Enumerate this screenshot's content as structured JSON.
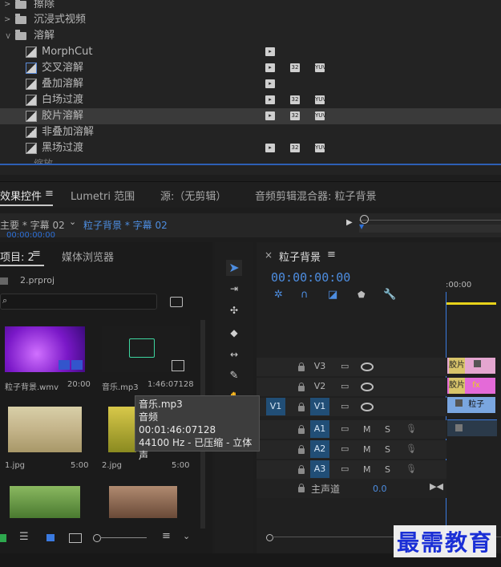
{
  "effects_tree": {
    "folders": [
      {
        "label": "擦除",
        "expanded": false
      },
      {
        "label": "沉浸式视频",
        "expanded": false
      },
      {
        "label": "溶解",
        "expanded": true
      }
    ],
    "items": [
      {
        "label": "MorphCut",
        "badges": [
          "accel"
        ]
      },
      {
        "label": "交叉溶解",
        "badges": [
          "accel",
          "32",
          "yuv"
        ],
        "highlight": true
      },
      {
        "label": "叠加溶解",
        "badges": [
          "accel"
        ]
      },
      {
        "label": "白场过渡",
        "badges": [
          "accel",
          "32",
          "yuv"
        ]
      },
      {
        "label": "胶片溶解",
        "badges": [
          "accel",
          "32",
          "yuv"
        ],
        "selected": true
      },
      {
        "label": "非叠加溶解",
        "badges": []
      },
      {
        "label": "黑场过渡",
        "badges": [
          "accel",
          "32",
          "yuv"
        ]
      }
    ],
    "partial_next": "缩放"
  },
  "panel_tabs": {
    "effect_controls": "效果控件",
    "lumetri": "Lumetri 范围",
    "source": "源:（无剪辑）",
    "audio_mixer": "音频剪辑混合器: 粒子背景",
    "menu_glyph": "≡"
  },
  "effect_controls_row": {
    "master": "主要 * 字幕 02",
    "clip": "粒子背景 * 字幕 02",
    "timecode": "00:00:00:00"
  },
  "project": {
    "tab": "项目: 2",
    "media_browser": "媒体浏览器",
    "file": "2.prproj",
    "items": [
      {
        "name": "粒子背景.wmv",
        "dur": "20:00"
      },
      {
        "name": "音乐.mp3",
        "dur": "1:46:07128"
      },
      {
        "name": "1.jpg",
        "dur": "5:00"
      },
      {
        "name": "2.jpg",
        "dur": "5:00"
      }
    ]
  },
  "tooltip": {
    "line1": "音乐.mp3",
    "line2": "音频",
    "line3": "00:01:46:07128",
    "line4": "44100 Hz - 已压缩 - 立体声"
  },
  "timeline": {
    "tab": "粒子背景",
    "timecode": "00:00:00:00",
    "ruler": ":00:00",
    "tracks": [
      {
        "name": "V3",
        "kind": "video"
      },
      {
        "name": "V2",
        "kind": "video"
      },
      {
        "name": "V1",
        "kind": "video",
        "source": "V1"
      },
      {
        "name": "A1",
        "kind": "audio"
      },
      {
        "name": "A2",
        "kind": "audio"
      },
      {
        "name": "A3",
        "kind": "audio"
      }
    ],
    "master": "主声道",
    "master_value": "0.0",
    "clip_labels": {
      "v3": "胶片",
      "v2": "胶片",
      "v1": "粒子"
    },
    "ms_m": "M",
    "ms_s": "S"
  },
  "watermark": "最需教育",
  "colors": {
    "accent": "#2d6fd6",
    "selection": "#3a3a3a",
    "track_active": "#214e76"
  }
}
